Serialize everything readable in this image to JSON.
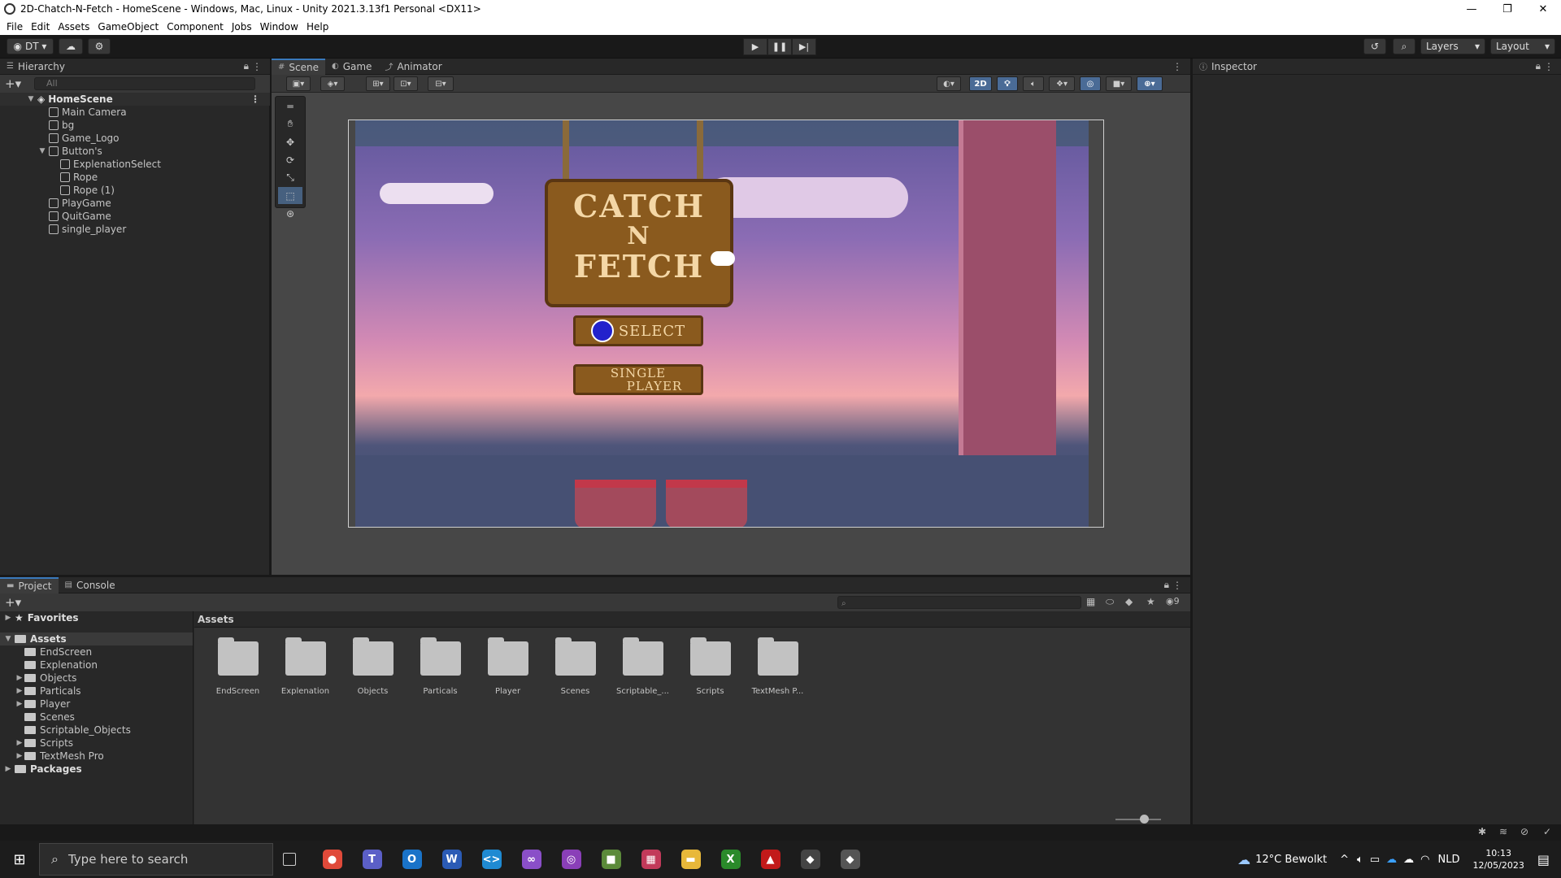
{
  "window": {
    "title": "2D-Chatch-N-Fetch - HomeScene - Windows, Mac, Linux - Unity 2021.3.13f1 Personal <DX11>",
    "controls": [
      "—",
      "❐",
      "✕"
    ]
  },
  "menu": [
    "File",
    "Edit",
    "Assets",
    "GameObject",
    "Component",
    "Jobs",
    "Window",
    "Help"
  ],
  "toolbar": {
    "account": "DT ▾",
    "layers": "Layers",
    "layout": "Layout"
  },
  "hierarchy": {
    "tab": "Hierarchy",
    "search_placeholder": "All",
    "scene": "HomeScene",
    "items": [
      {
        "label": "Main Camera",
        "indent": 1,
        "arrow": ""
      },
      {
        "label": "bg",
        "indent": 1,
        "arrow": ""
      },
      {
        "label": "Game_Logo",
        "indent": 1,
        "arrow": ""
      },
      {
        "label": "Button's",
        "indent": 1,
        "arrow": "▼"
      },
      {
        "label": "ExplenationSelect",
        "indent": 2,
        "arrow": ""
      },
      {
        "label": "Rope",
        "indent": 2,
        "arrow": ""
      },
      {
        "label": "Rope (1)",
        "indent": 2,
        "arrow": ""
      },
      {
        "label": "PlayGame",
        "indent": 1,
        "arrow": ""
      },
      {
        "label": "QuitGame",
        "indent": 1,
        "arrow": ""
      },
      {
        "label": "single_player",
        "indent": 1,
        "arrow": ""
      }
    ]
  },
  "scene_panel": {
    "tabs": [
      "Scene",
      "Game",
      "Animator"
    ],
    "toggle_2d": "2D",
    "game": {
      "logo_line1": "CATCH",
      "logo_line2": "N",
      "logo_line3": "FETCH",
      "select_label": "SELECT",
      "single_player_line1": "SINGLE",
      "single_player_line2": "PLAYER"
    }
  },
  "inspector": {
    "tab": "Inspector"
  },
  "project": {
    "tabs": [
      "Project",
      "Console"
    ],
    "hidden_count": "9",
    "favorites": "Favorites",
    "assets_root": "Assets",
    "packages": "Packages",
    "tree": [
      {
        "label": "EndScreen",
        "arrow": ""
      },
      {
        "label": "Explenation",
        "arrow": ""
      },
      {
        "label": "Objects",
        "arrow": "▶"
      },
      {
        "label": "Particals",
        "arrow": "▶"
      },
      {
        "label": "Player",
        "arrow": "▶"
      },
      {
        "label": "Scenes",
        "arrow": ""
      },
      {
        "label": "Scriptable_Objects",
        "arrow": ""
      },
      {
        "label": "Scripts",
        "arrow": "▶"
      },
      {
        "label": "TextMesh Pro",
        "arrow": "▶"
      }
    ],
    "breadcrumb": "Assets",
    "folders": [
      "EndScreen",
      "Explenation",
      "Objects",
      "Particals",
      "Player",
      "Scenes",
      "Scriptable_...",
      "Scripts",
      "TextMesh P..."
    ]
  },
  "taskbar": {
    "search_placeholder": "Type here to search",
    "apps": [
      {
        "icon": "chrome-icon",
        "color": "#e04a3a",
        "glyph": "●"
      },
      {
        "icon": "teams-icon",
        "color": "#5b5fc7",
        "glyph": "T"
      },
      {
        "icon": "outlook-icon",
        "color": "#1a73c8",
        "glyph": "O"
      },
      {
        "icon": "word-icon",
        "color": "#2b5bb5",
        "glyph": "W"
      },
      {
        "icon": "vscode-icon",
        "color": "#1f8ad2",
        "glyph": "<>"
      },
      {
        "icon": "visual-studio-icon",
        "color": "#8a4fc8",
        "glyph": "∞"
      },
      {
        "icon": "github-desktop-icon",
        "color": "#8a3fb8",
        "glyph": "◎"
      },
      {
        "icon": "minecraft-icon",
        "color": "#5b8a3a",
        "glyph": "■"
      },
      {
        "icon": "calendar-app-icon",
        "color": "#c23a5a",
        "glyph": "▦"
      },
      {
        "icon": "file-explorer-icon",
        "color": "#e8b83a",
        "glyph": "▬"
      },
      {
        "icon": "xbox-icon",
        "color": "#2a8a2a",
        "glyph": "X"
      },
      {
        "icon": "game-launcher-icon",
        "color": "#c21a1a",
        "glyph": "▲"
      },
      {
        "icon": "unity-hub-icon",
        "color": "#444444",
        "glyph": "◆"
      },
      {
        "icon": "unity-editor-icon",
        "color": "#555555",
        "glyph": "◆"
      }
    ],
    "weather": "12°C  Bewolkt",
    "language": "NLD",
    "time": "10:13",
    "date": "12/05/2023"
  }
}
